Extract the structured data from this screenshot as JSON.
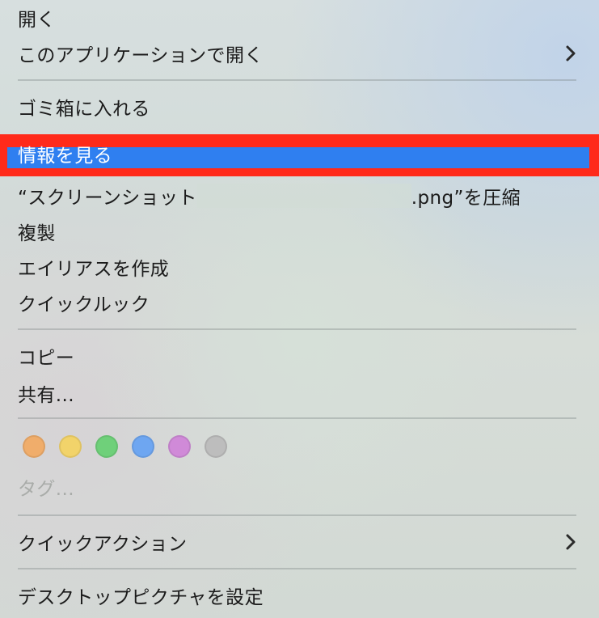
{
  "menu": {
    "open": "開く",
    "open_with": "このアプリケーションで開く",
    "move_to_trash": "ゴミ箱に入れる",
    "get_info": "情報を見る",
    "compress_prefix": "“スクリーンショット",
    "compress_suffix": ".png”を圧縮",
    "duplicate": "複製",
    "make_alias": "エイリアスを作成",
    "quick_look": "クイックルック",
    "copy": "コピー",
    "share": "共有...",
    "tags": "タグ...",
    "quick_actions": "クイックアクション",
    "set_desktop_picture": "デスクトップピクチャを設定"
  },
  "tag_colors": [
    {
      "name": "orange",
      "color": "#f0ad6b"
    },
    {
      "name": "yellow",
      "color": "#f2d36a"
    },
    {
      "name": "green",
      "color": "#6fd07a"
    },
    {
      "name": "blue",
      "color": "#6ea6f1"
    },
    {
      "name": "purple",
      "color": "#d08ad8"
    },
    {
      "name": "gray",
      "color": "#bdbdbd"
    }
  ],
  "colors": {
    "highlight_bg": "#2f7ff0",
    "annotation_red": "#ff2a1a",
    "chevron": "#2a2a2a"
  },
  "icons": {
    "submenu": "chevron-right-icon"
  }
}
